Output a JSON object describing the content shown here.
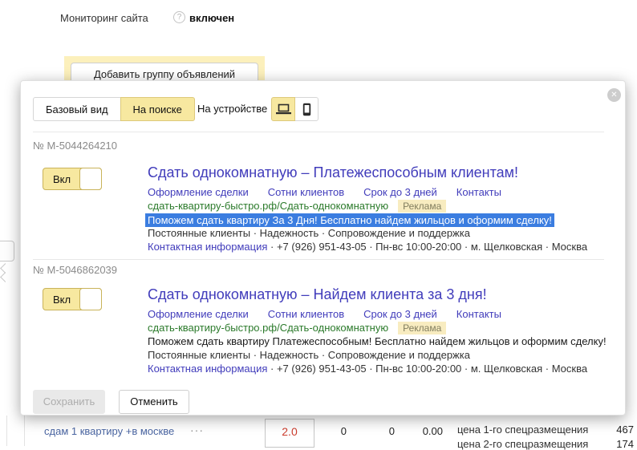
{
  "top_bar": {
    "monitoring_label": "Мониторинг сайта",
    "help_icon": "?",
    "monitoring_value": "включен",
    "add_group_button": "Добавить группу объявлений"
  },
  "modal": {
    "close_icon": "✕",
    "view_tabs": [
      {
        "label": "Базовый вид"
      },
      {
        "label": "На поиске"
      }
    ],
    "device_label": "На устройстве",
    "ads": [
      {
        "number": "№ М-5044264210",
        "toggle_label": "Вкл",
        "title": "Сдать однокомнатную – Платежеспособным клиентам!",
        "sitelinks": [
          "Оформление сделки",
          "Сотни клиентов",
          "Срок до 3 дней",
          "Контакты"
        ],
        "display_url": "сдать-квартиру-быстро.рф/Сдать-однокомнатную",
        "ad_badge": "Реклама",
        "description": "Поможем сдать квартиру За 3 Дня! Бесплатно найдем жильцов и оформим сделку!",
        "features": "Постоянные клиенты · Надежность · Сопровождение и поддержка",
        "contact_link": "Контактная информация",
        "contact_details": "· +7 (926) 951-43-05 · Пн-вс 10:00-20:00 · м. Щелковская · Москва"
      },
      {
        "number": "№ М-5046862039",
        "toggle_label": "Вкл",
        "title": "Сдать однокомнатную – Найдем клиента за 3 дня!",
        "sitelinks": [
          "Оформление сделки",
          "Сотни клиентов",
          "Срок до 3 дней",
          "Контакты"
        ],
        "display_url": "сдать-квартиру-быстро.рф/Сдать-однокомнатную",
        "ad_badge": "Реклама",
        "description": "Поможем сдать квартиру Платежеспособным! Бесплатно найдем жильцов и оформим сделку!",
        "features": "Постоянные клиенты · Надежность · Сопровождение и поддержка",
        "contact_link": "Контактная информация",
        "contact_details": "· +7 (926) 951-43-05 · Пн-вс 10:00-20:00 · м. Щелковская · Москва"
      }
    ],
    "save_button": "Сохранить",
    "cancel_button": "Отменить"
  },
  "keyword_row": {
    "keyword": "сдам 1 квартиру +в москве",
    "menu_dots": "···",
    "bid": "2.0",
    "stats": [
      "0",
      "0",
      "0.00"
    ],
    "prices": [
      {
        "label": "цена 1-го спецразмещения",
        "value": "467"
      },
      {
        "label": "цена 2-го спецразмещения",
        "value": "174"
      }
    ]
  },
  "colors": {
    "accent_yellow": "#f7e8a0",
    "link_purple": "#413cbb",
    "url_green": "#2b7a2b",
    "selection_blue": "#3b7de0",
    "bid_red": "#cc3d2e"
  }
}
